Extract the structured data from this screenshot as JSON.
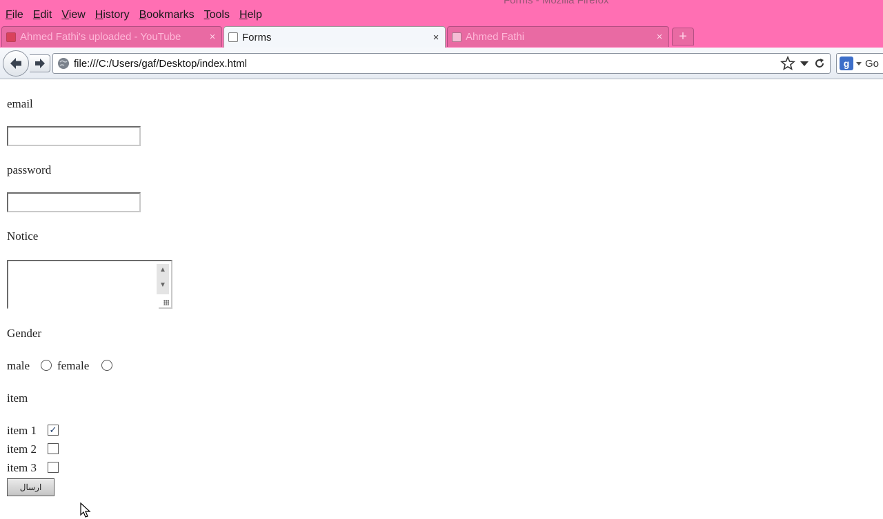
{
  "window": {
    "title": "Forms - Mozilla Firefox"
  },
  "menu": [
    "File",
    "Edit",
    "View",
    "History",
    "Bookmarks",
    "Tools",
    "Help"
  ],
  "tabs": [
    {
      "label": "Ahmed Fathi's uploaded - YouTube",
      "active": false,
      "favicon": "youtube-icon"
    },
    {
      "label": "Forms",
      "active": true,
      "favicon": "page-icon"
    },
    {
      "label": "Ahmed Fathi",
      "active": false,
      "favicon": "page-icon"
    }
  ],
  "tab_close_glyph": "×",
  "new_tab_glyph": "+",
  "nav": {
    "url": "file:///C:/Users/gaf/Desktop/index.html",
    "search_placeholder": "Go"
  },
  "form": {
    "email_label": "email",
    "email_value": "",
    "password_label": "password",
    "password_value": "",
    "notice_label": "Notice",
    "notice_value": "",
    "gender_label": "Gender",
    "gender_options": [
      "male",
      "female"
    ],
    "item_label": "item",
    "items": [
      {
        "label": "item 1",
        "checked": true
      },
      {
        "label": "item 2",
        "checked": false
      },
      {
        "label": "item 3",
        "checked": false
      }
    ],
    "submit_label": "ارسال"
  },
  "colors": {
    "titlebar": "#ff6fb3",
    "navbar": "#eef2f7"
  }
}
